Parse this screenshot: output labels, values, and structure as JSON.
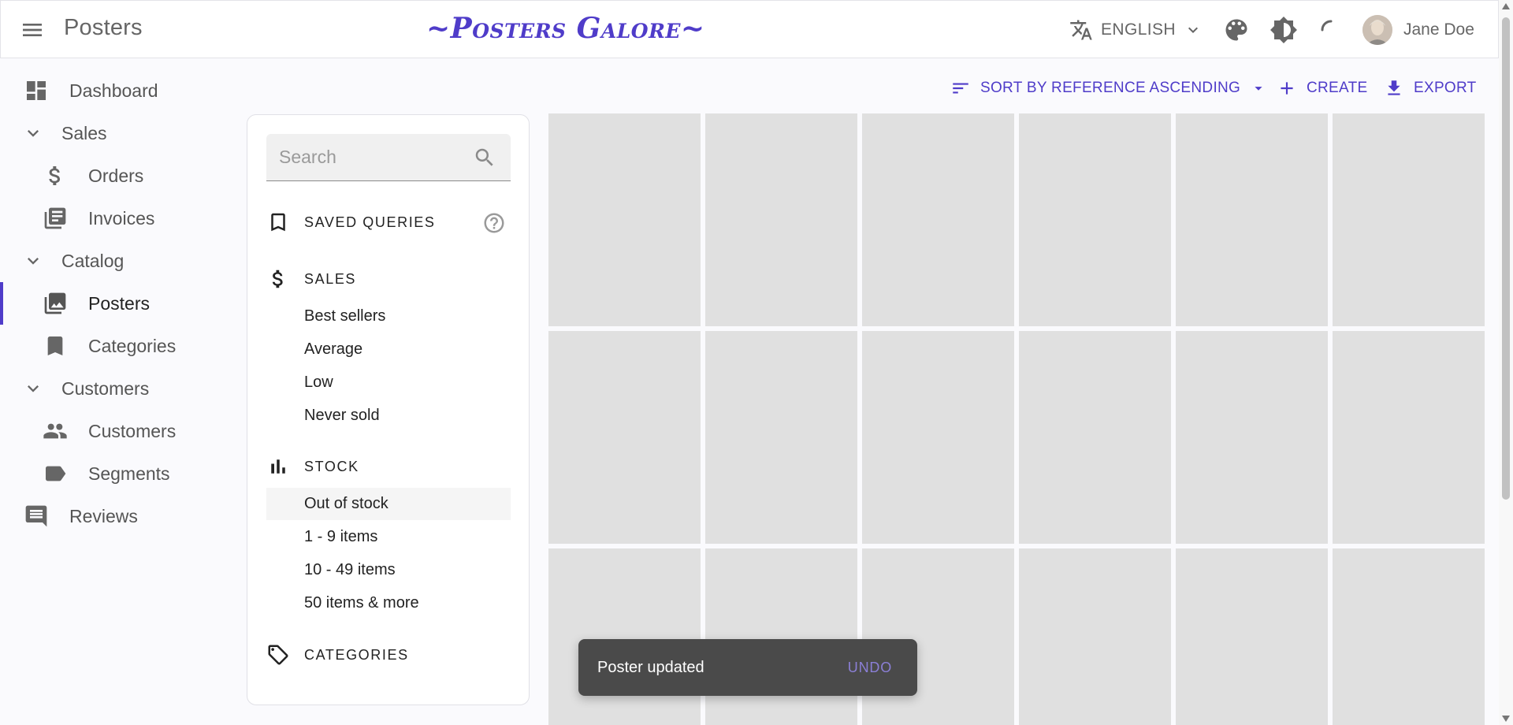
{
  "header": {
    "title": "Posters",
    "brand": "~Posters Galore~",
    "language": "ENGLISH",
    "user_name": "Jane Doe"
  },
  "sidebar": {
    "items": [
      {
        "label": "Dashboard",
        "icon": "dashboard-icon"
      },
      {
        "label": "Sales",
        "icon": "chevron-down-icon"
      },
      {
        "label": "Orders",
        "icon": "dollar-icon"
      },
      {
        "label": "Invoices",
        "icon": "invoices-icon"
      },
      {
        "label": "Catalog",
        "icon": "chevron-down-icon"
      },
      {
        "label": "Posters",
        "icon": "posters-icon",
        "active": true
      },
      {
        "label": "Categories",
        "icon": "bookmark-icon"
      },
      {
        "label": "Customers",
        "icon": "chevron-down-icon"
      },
      {
        "label": "Customers",
        "icon": "people-icon"
      },
      {
        "label": "Segments",
        "icon": "label-icon"
      },
      {
        "label": "Reviews",
        "icon": "comment-icon"
      }
    ]
  },
  "toolbar": {
    "sort_label": "SORT BY REFERENCE ASCENDING",
    "create_label": "CREATE",
    "export_label": "EXPORT"
  },
  "filters": {
    "search_placeholder": "Search",
    "saved_queries": "SAVED QUERIES",
    "sales": {
      "title": "SALES",
      "items": [
        "Best sellers",
        "Average",
        "Low",
        "Never sold"
      ]
    },
    "stock": {
      "title": "STOCK",
      "items": [
        "Out of stock",
        "1 - 9 items",
        "10 - 49 items",
        "50 items & more"
      ],
      "selected": "Out of stock"
    },
    "categories": "CATEGORIES"
  },
  "snackbar": {
    "message": "Poster updated",
    "action": "UNDO"
  },
  "colors": {
    "primary": "#4f3cc9",
    "tile_placeholder": "#e0e0e0",
    "snackbar_bg": "#4a4a4a"
  }
}
